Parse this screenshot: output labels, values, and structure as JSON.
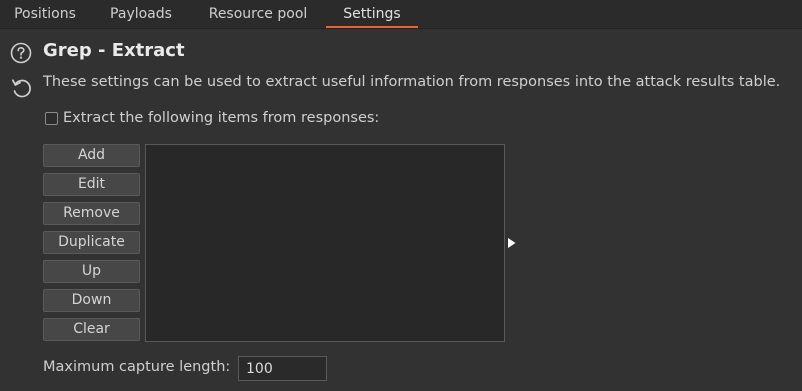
{
  "tabs": [
    {
      "label": "Positions",
      "active": false
    },
    {
      "label": "Payloads",
      "active": false
    },
    {
      "label": "Resource pool",
      "active": false
    },
    {
      "label": "Settings",
      "active": true
    }
  ],
  "section": {
    "title": "Grep - Extract",
    "description": "These settings can be used to extract useful information from responses into the attack results table.",
    "help_icon": "question-circle-icon",
    "reset_icon": "reset-arrow-icon"
  },
  "extract_checkbox": {
    "label": "Extract the following items from responses:",
    "checked": false
  },
  "buttons": {
    "add": "Add",
    "edit": "Edit",
    "remove": "Remove",
    "duplicate": "Duplicate",
    "up": "Up",
    "down": "Down",
    "clear": "Clear"
  },
  "list": {
    "items": []
  },
  "max_capture": {
    "label": "Maximum capture length:",
    "value": "100"
  },
  "colors": {
    "background": "#323232",
    "tab_accent": "#e8643a"
  }
}
